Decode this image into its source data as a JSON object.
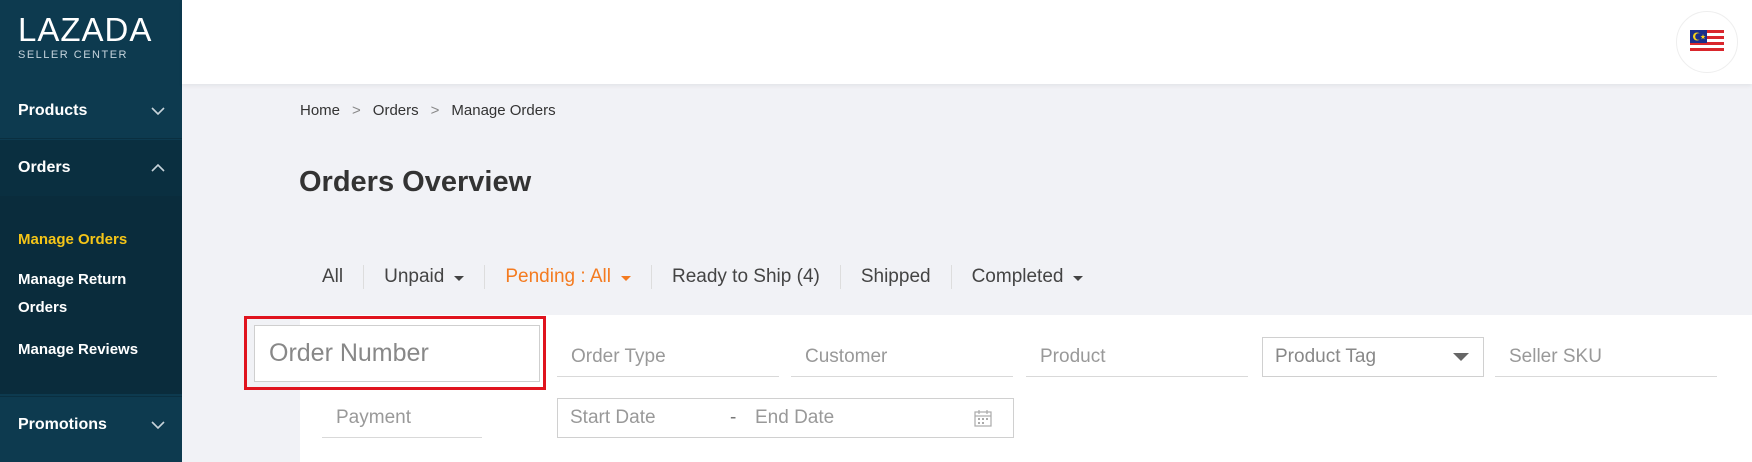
{
  "brand": {
    "logo_main": "LAZADA",
    "logo_sub": "SELLER CENTER"
  },
  "sidebar": {
    "sections": [
      {
        "label": "Products",
        "icon": "chevron-down-icon"
      },
      {
        "label": "Orders",
        "icon": "chevron-up-icon"
      },
      {
        "label": "Promotions",
        "icon": "chevron-down-icon"
      }
    ],
    "orders_submenu": [
      {
        "label": "Manage Orders",
        "active": true
      },
      {
        "label": "Manage Return Orders",
        "active": false
      },
      {
        "label": "Manage Reviews",
        "active": false
      }
    ]
  },
  "topbar": {
    "country_flag": "malaysia-flag-icon"
  },
  "breadcrumb": [
    "Home",
    "Orders",
    "Manage Orders"
  ],
  "breadcrumb_separator": ">",
  "page_title": "Orders Overview",
  "tabs": [
    {
      "label": "All"
    },
    {
      "label": "Unpaid"
    },
    {
      "label": "Pending : All"
    },
    {
      "label": "Ready to Ship (4)"
    },
    {
      "label": "Shipped"
    },
    {
      "label": "Completed"
    }
  ],
  "filters": {
    "order_number_placeholder": "Order Number",
    "order_type_placeholder": "Order Type",
    "customer_placeholder": "Customer",
    "product_placeholder": "Product",
    "product_tag_label": "Product Tag",
    "seller_sku_placeholder": "Seller SKU",
    "payment_placeholder": "Payment",
    "start_date_placeholder": "Start Date",
    "date_separator": "-",
    "end_date_placeholder": "End Date"
  },
  "colors": {
    "sidebar_bg": "#0d3a4f",
    "submenu_active": "#f5c518",
    "tab_active": "#f47b20",
    "highlight_border": "#e0141e"
  }
}
